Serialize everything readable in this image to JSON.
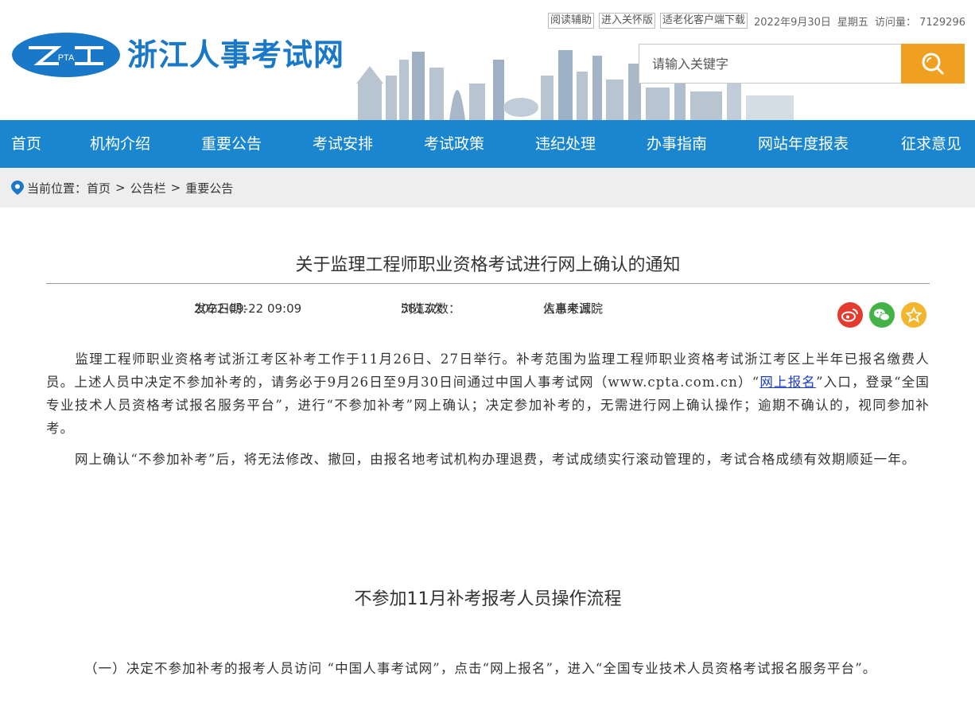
{
  "header": {
    "site_title": "浙江人事考试网",
    "logo_text": "PTA",
    "util": {
      "reading_aid": "阅读辅助",
      "care_version": "进入关怀版",
      "elderly_download": "适老化客户端下载",
      "date": "2022年9月30日",
      "weekday": "星期五",
      "visits_label": "访问量：",
      "visits_value": "7129296"
    },
    "search": {
      "placeholder": "请输入关键字"
    }
  },
  "nav": {
    "items": [
      "首页",
      "机构介绍",
      "重要公告",
      "考试安排",
      "考试政策",
      "违纪处理",
      "办事指南",
      "网站年度报表",
      "征求意见"
    ]
  },
  "breadcrumb": {
    "label": "当前位置：",
    "items": [
      "首页",
      "公告栏",
      "重要公告"
    ],
    "separator": ">"
  },
  "article": {
    "title": "关于监理工程师职业资格考试进行网上确认的通知",
    "publish_label": "发布日期：",
    "publish_date": "2022-09-22 09:09",
    "views_label": "浏览次数：",
    "views_value": "5813次",
    "source_label": "信息来源：",
    "source_value": "人事考试院",
    "p1_before_link": "监理工程师职业资格考试浙江考区补考工作于11月26日、27日举行。补考范围为监理工程师职业资格考试浙江考区上半年已报名缴费人员。上述人员中决定不参加补考的，请务必于9月26日至9月30日间通过中国人事考试网（www.cpta.com.cn）“",
    "p1_link": "网上报名",
    "p1_after_link": "”入口，登录“全国专业技术人员资格考试报名服务平台”，进行“不参加补考”网上确认；决定参加补考的，无需进行网上确认操作；逾期不确认的，视同参加补考。",
    "p2": "网上确认“不参加补考”后，将无法修改、撤回，由报名地考试机构办理退费，考试成绩实行滚动管理的，考试合格成绩有效期顺延一年。",
    "section_title": "不参加11月补考报考人员操作流程",
    "p3": "（一）决定不参加补考的报考人员访问 “中国人事考试网”，点击“网上报名”，进入“全国专业技术人员资格考试报名服务平台”。"
  },
  "colors": {
    "brand_blue": "#1a86d0",
    "title_blue": "#1a78c8",
    "search_orange": "#f0a020",
    "weibo_red": "#e53a2e",
    "wechat_green": "#43b348",
    "fav_yellow": "#f2b52c"
  }
}
